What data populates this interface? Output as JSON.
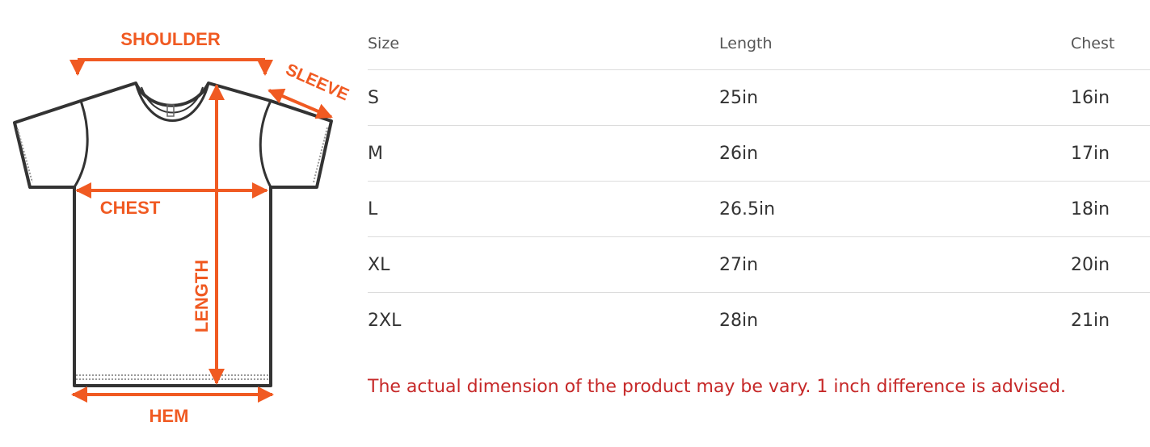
{
  "diagram": {
    "labels": {
      "shoulder": "SHOULDER",
      "sleeve": "SLEEVE",
      "chest": "CHEST",
      "length": "LENGTH",
      "hem": "HEM"
    },
    "accent_color": "#f05a22",
    "outline_color": "#333333"
  },
  "table": {
    "headers": [
      "Size",
      "Length",
      "Chest"
    ],
    "rows": [
      [
        "S",
        "25in",
        "16in"
      ],
      [
        "M",
        "26in",
        "17in"
      ],
      [
        "L",
        "26.5in",
        "18in"
      ],
      [
        "XL",
        "27in",
        "20in"
      ],
      [
        "2XL",
        "28in",
        "21in"
      ]
    ]
  },
  "note": "The actual dimension of the product may be vary. 1 inch difference is advised.",
  "note_color": "#c62828"
}
